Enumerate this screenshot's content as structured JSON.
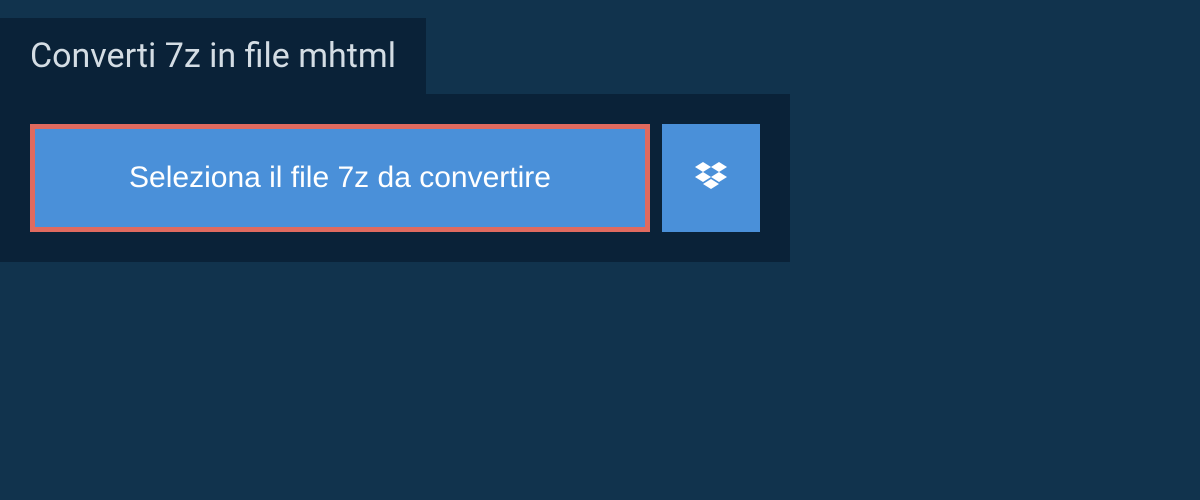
{
  "header": {
    "title": "Converti 7z in file mhtml"
  },
  "upload": {
    "select_button_label": "Seleziona il file 7z da convertire"
  },
  "colors": {
    "background": "#11334d",
    "panel": "#0a2238",
    "button": "#4a90d9",
    "accent_border": "#e06a5f",
    "text_light": "#d4dde4",
    "text_white": "#ffffff"
  }
}
